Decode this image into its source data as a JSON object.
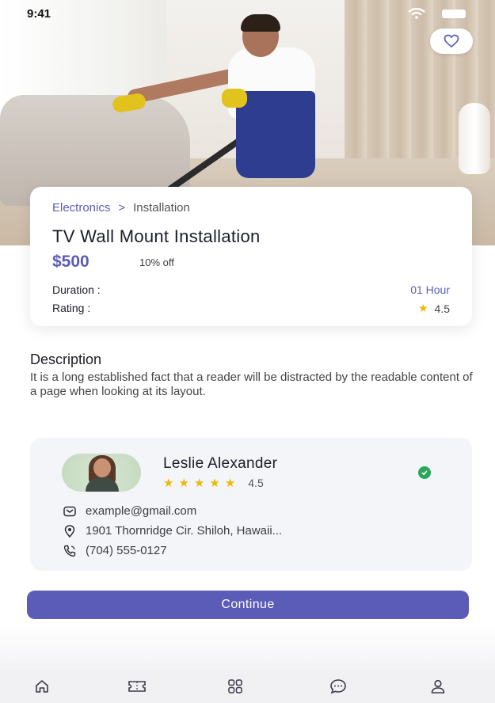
{
  "status_bar": {
    "time": "9:41"
  },
  "service": {
    "breadcrumb": {
      "category": "Electronics",
      "separator": ">",
      "subcategory": "Installation"
    },
    "title": "TV Wall Mount Installation",
    "price": "$500",
    "discount": "10% off",
    "duration_label": "Duration :",
    "duration_value": "01 Hour",
    "rating_label": "Rating :",
    "rating_value": "4.5"
  },
  "description": {
    "title": "Description",
    "text": "It is a long established fact that a reader will be distracted by the readable content of a page when looking at its layout."
  },
  "provider": {
    "name": "Leslie Alexander",
    "rating": "4.5",
    "stars": 5,
    "email": "example@gmail.com",
    "address": "1901 Thornridge Cir. Shiloh, Hawaii...",
    "phone": "(704) 555-0127"
  },
  "actions": {
    "continue_label": "Continue"
  },
  "colors": {
    "accent": "#5b5bb8",
    "star": "#f2b705",
    "verified": "#2aa85a"
  },
  "nav": {
    "icons": [
      "home-icon",
      "ticket-icon",
      "grid-icon",
      "chat-icon",
      "profile-icon"
    ]
  }
}
